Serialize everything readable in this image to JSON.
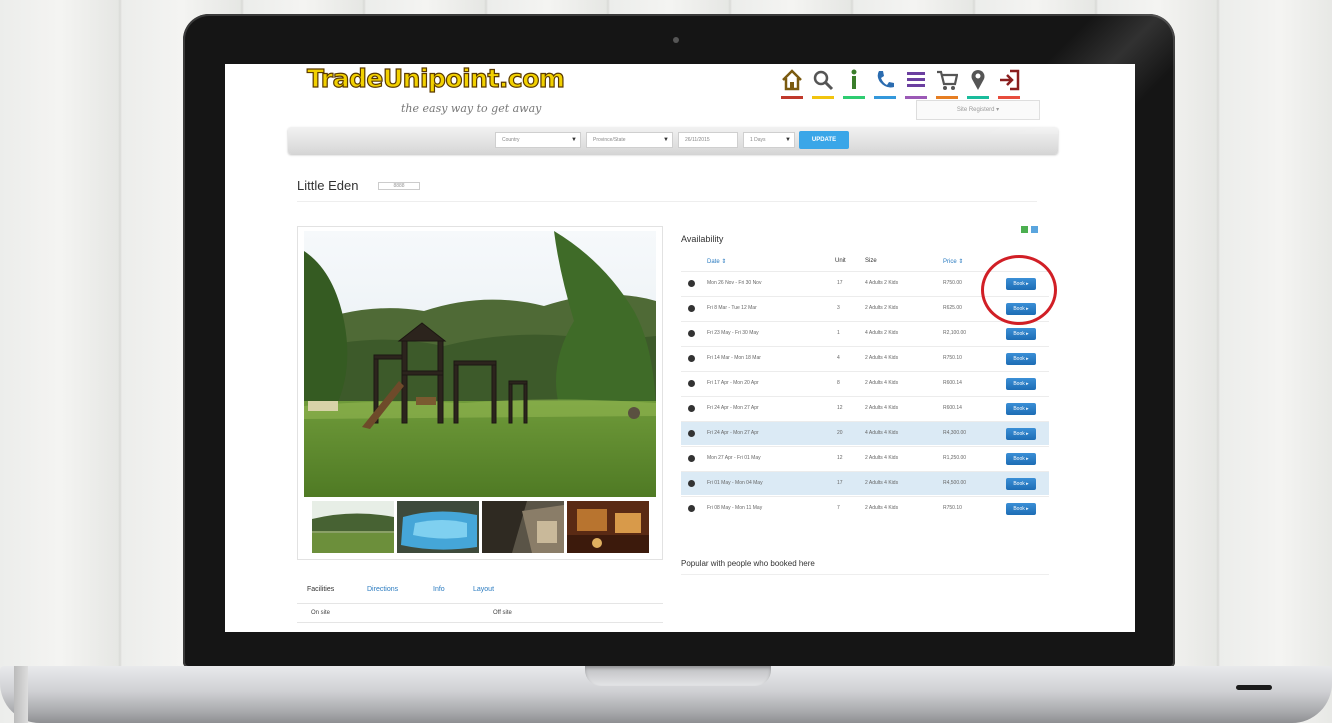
{
  "site": {
    "logo_text": "TradeUnipoint.com",
    "tagline": "the easy way to get away",
    "login_label": "Site Registerd ▾",
    "header_icons": [
      "home-icon",
      "search-icon",
      "info-icon",
      "phone-icon",
      "menu-icon",
      "cart-icon",
      "map-pin-icon",
      "sign-in-icon"
    ],
    "icon_underline_colors": [
      "#c0392b",
      "#f1c40f",
      "#2ecc71",
      "#3498db",
      "#9b59b6",
      "#e67e22",
      "#1abc9c",
      "#e74c3c"
    ]
  },
  "search": {
    "country": "Country",
    "province": "Province/State",
    "date": "26/11/2015",
    "nights": "1 Days",
    "update_label": "UPDATE"
  },
  "listing": {
    "title": "Little Eden",
    "badge": "8888"
  },
  "gallery": {
    "thumbs": [
      "garden-photo",
      "pool-photo",
      "lodge-photo",
      "interior-photo"
    ]
  },
  "tabs": {
    "items": [
      "Facilities",
      "Directions",
      "Info",
      "Layout"
    ],
    "sub_left": "On site",
    "sub_right": "Off site"
  },
  "availability": {
    "title": "Availability",
    "headers": {
      "date": "Date ⇕",
      "unit": "Unit",
      "size": "Size",
      "price": "Price ⇕"
    },
    "book_label": "Book ▸",
    "rows": [
      {
        "date": "Mon 26 Nov - Fri 30 Nov",
        "unit": "17",
        "size": "4 Adults 2 Kids",
        "price": "R750.00",
        "highlight": false
      },
      {
        "date": "Fri 8 Mar - Tue 12 Mar",
        "unit": "3",
        "size": "2 Adults 2 Kids",
        "price": "R625.00",
        "highlight": false
      },
      {
        "date": "Fri 23 May - Fri 30 May",
        "unit": "1",
        "size": "4 Adults 2 Kids",
        "price": "R2,100.00",
        "highlight": false
      },
      {
        "date": "Fri 14 Mar - Mon 18 Mar",
        "unit": "4",
        "size": "2 Adults 4 Kids",
        "price": "R750.10",
        "highlight": false
      },
      {
        "date": "Fri 17 Apr - Mon 20 Apr",
        "unit": "8",
        "size": "2 Adults 4 Kids",
        "price": "R600.14",
        "highlight": false
      },
      {
        "date": "Fri 24 Apr - Mon 27 Apr",
        "unit": "12",
        "size": "2 Adults 4 Kids",
        "price": "R600.14",
        "highlight": false
      },
      {
        "date": "Fri 24 Apr - Mon 27 Apr",
        "unit": "20",
        "size": "4 Adults 4 Kids",
        "price": "R4,300.00",
        "highlight": true
      },
      {
        "date": "Mon 27 Apr - Fri 01 May",
        "unit": "12",
        "size": "2 Adults 4 Kids",
        "price": "R1,250.00",
        "highlight": false
      },
      {
        "date": "Fri 01 May - Mon 04 May",
        "unit": "17",
        "size": "2 Adults 4 Kids",
        "price": "R4,500.00",
        "highlight": true
      },
      {
        "date": "Fri 08 May - Mon 11 May",
        "unit": "7",
        "size": "2 Adults 4 Kids",
        "price": "R750.10",
        "highlight": false
      }
    ]
  },
  "popular": {
    "title": "Popular with people who booked here"
  }
}
